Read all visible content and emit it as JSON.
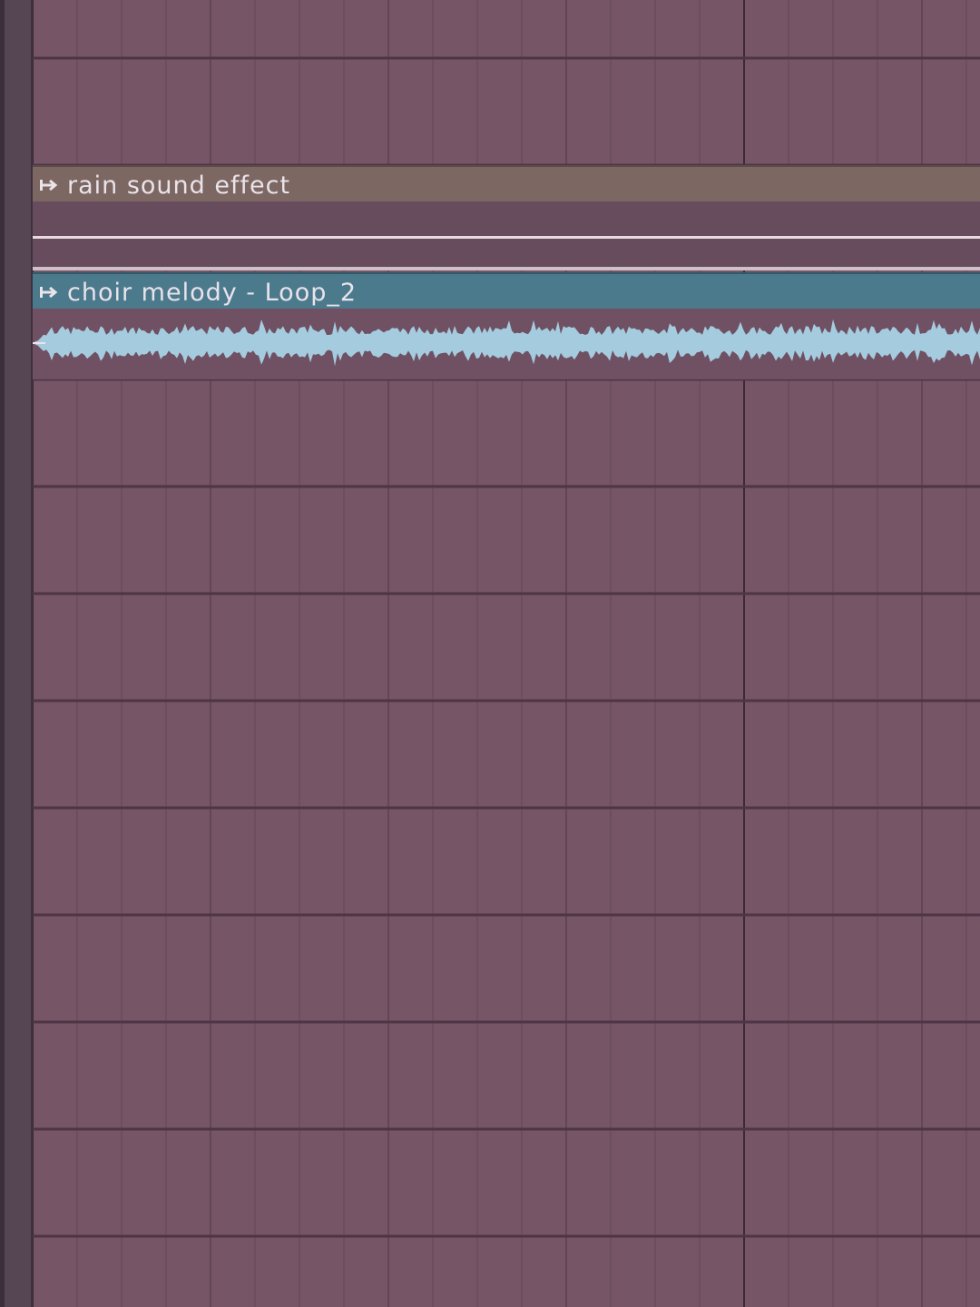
{
  "playlist": {
    "background_color": "#755566",
    "clips": [
      {
        "name": "rain sound effect",
        "color": "#7c6762",
        "icon": "clip-menu-icon"
      },
      {
        "name": "choir melody - Loop_2",
        "color": "#4c7a8d",
        "waveform_color": "#a4ccde",
        "icon": "clip-menu-icon"
      }
    ]
  }
}
